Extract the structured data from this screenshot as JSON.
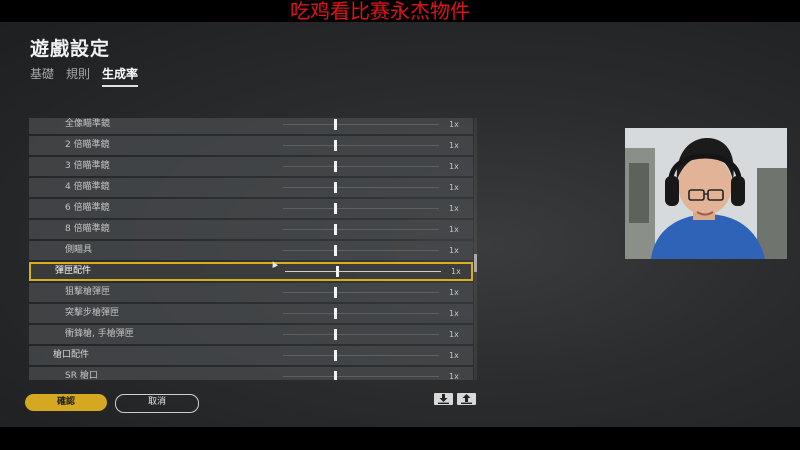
{
  "overlay": {
    "banner_text": "吃鸡看比赛永杰物件"
  },
  "header": {
    "title": "遊戲設定"
  },
  "tabs": [
    {
      "label": "基礎",
      "active": false
    },
    {
      "label": "規則",
      "active": false
    },
    {
      "label": "生成率",
      "active": true
    }
  ],
  "spawn_rates": [
    {
      "label": "全像瞄準鏡",
      "value": "1x",
      "level": 0.33,
      "group": false,
      "selected": false
    },
    {
      "label": "2 倍瞄準鏡",
      "value": "1x",
      "level": 0.33,
      "group": false,
      "selected": false
    },
    {
      "label": "3 倍瞄準鏡",
      "value": "1x",
      "level": 0.33,
      "group": false,
      "selected": false
    },
    {
      "label": "4 倍瞄準鏡",
      "value": "1x",
      "level": 0.33,
      "group": false,
      "selected": false
    },
    {
      "label": "6 倍瞄準鏡",
      "value": "1x",
      "level": 0.33,
      "group": false,
      "selected": false
    },
    {
      "label": "8 倍瞄準鏡",
      "value": "1x",
      "level": 0.33,
      "group": false,
      "selected": false
    },
    {
      "label": "側瞄具",
      "value": "1x",
      "level": 0.33,
      "group": false,
      "selected": false
    },
    {
      "label": "彈匣配件",
      "value": "1x",
      "level": 0.33,
      "group": true,
      "selected": true
    },
    {
      "label": "狙擊槍彈匣",
      "value": "1x",
      "level": 0.33,
      "group": false,
      "selected": false
    },
    {
      "label": "突擊步槍彈匣",
      "value": "1x",
      "level": 0.33,
      "group": false,
      "selected": false
    },
    {
      "label": "衝鋒槍, 手槍彈匣",
      "value": "1x",
      "level": 0.33,
      "group": false,
      "selected": false
    },
    {
      "label": "槍口配件",
      "value": "1x",
      "level": 0.33,
      "group": true,
      "selected": false
    },
    {
      "label": "SR 槍口",
      "value": "1x",
      "level": 0.33,
      "group": false,
      "selected": false
    }
  ],
  "footer": {
    "confirm_label": "確認",
    "cancel_label": "取消",
    "download_icon": "download-icon",
    "upload_icon": "upload-icon"
  },
  "colors": {
    "accent": "#d4a921",
    "overlay_text": "#e0121a"
  }
}
